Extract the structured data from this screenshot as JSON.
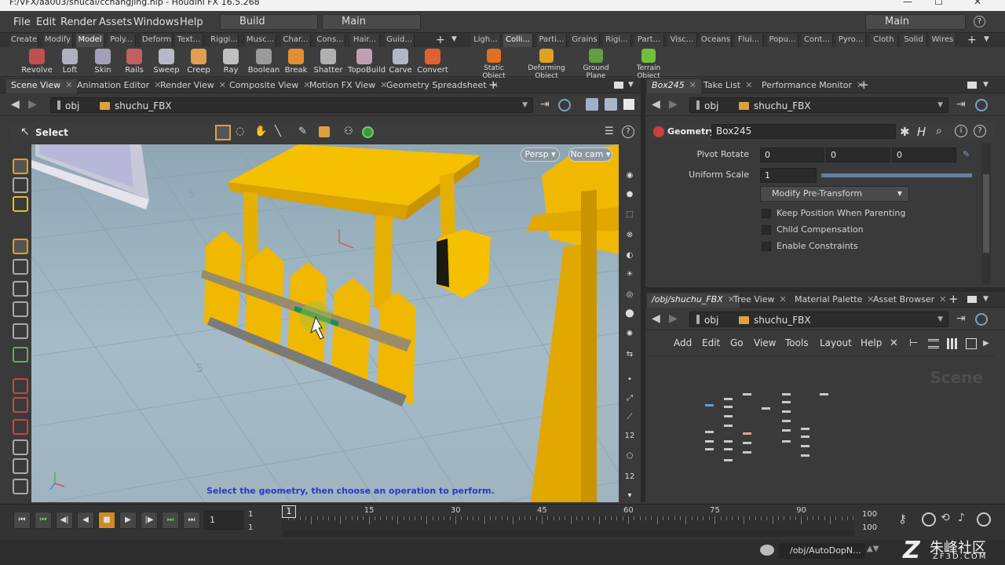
{
  "title_bar": {
    "text": "F:/VFX/aa003/shucai/cchangjing.hip - Houdini FX 16.5.268",
    "minimize": "—",
    "maximize": "☐",
    "close": "✕"
  },
  "menu": {
    "items": [
      "File",
      "Edit",
      "Render",
      "Assets",
      "Windows",
      "Help"
    ],
    "build_desktop": "Build",
    "main_desktop": "Main",
    "right_desktop": "Main",
    "help_glyph": "?"
  },
  "shelf": {
    "left_tabs": [
      "Create",
      "Modify",
      "Model",
      "Poly...",
      "Deform",
      "Text...",
      "Riggi...",
      "Musc...",
      "Char...",
      "Cons...",
      "Hair...",
      "Guid..."
    ],
    "left_active": "Model",
    "right_tabs": [
      "Ligh...",
      "Colli...",
      "Parti...",
      "Grains",
      "Rigi...",
      "Part...",
      "Visc...",
      "Oceans",
      "Flui...",
      "Popu...",
      "Cont...",
      "Pyro...",
      "Cloth",
      "Solid",
      "Wires"
    ],
    "right_active": "Colli...",
    "left_tools": [
      {
        "label": "Revolve",
        "color": "#c05050"
      },
      {
        "label": "Loft",
        "color": "#b0b0c0"
      },
      {
        "label": "Skin",
        "color": "#a0a0b8"
      },
      {
        "label": "Rails",
        "color": "#c06060"
      },
      {
        "label": "Sweep",
        "color": "#b8b8c8"
      },
      {
        "label": "Creep",
        "color": "#e0a050"
      },
      {
        "label": "Ray",
        "color": "#c0c0c0"
      },
      {
        "label": "Boolean",
        "color": "#9a9a9a"
      },
      {
        "label": "Break",
        "color": "#e09030"
      },
      {
        "label": "Shatter",
        "color": "#b0b0b0"
      },
      {
        "label": "TopoBuild",
        "color": "#c0a0b0"
      },
      {
        "label": "Carve",
        "color": "#b0b8c8"
      },
      {
        "label": "Convert",
        "color": "#e06030"
      }
    ],
    "right_tools": [
      {
        "label": "Static Object",
        "color": "#e07020"
      },
      {
        "label": "Deforming Object",
        "color": "#e0a020"
      },
      {
        "label": "Ground Plane",
        "color": "#60a040"
      },
      {
        "label": "Terrain Object",
        "color": "#70c040"
      }
    ]
  },
  "left_pane": {
    "tabs": [
      "Scene View",
      "Animation Editor",
      "Render View",
      "Composite View",
      "Motion FX View",
      "Geometry Spreadsheet"
    ],
    "active_tab": "Scene View",
    "path": [
      "obj",
      "shuchu_FBX"
    ],
    "select_label": "Select",
    "persp_button": "Persp",
    "cam_button": "No cam",
    "status_message": "Select the geometry, then choose an operation to perform."
  },
  "params_pane": {
    "tabs": [
      "Box245",
      "Take List",
      "Performance Monitor"
    ],
    "active_tab": "Box245",
    "path": [
      "obj",
      "shuchu_FBX"
    ],
    "node_type": "Geometry",
    "node_name": "Box245",
    "pivot_rotate_label": "Pivot Rotate",
    "pivot_rotate": [
      "0",
      "0",
      "0"
    ],
    "uniform_scale_label": "Uniform Scale",
    "uniform_scale": "1",
    "uniform_scale_fraction": 1.0,
    "modify_pre_transform": "Modify Pre-Transform",
    "checkboxes": [
      "Keep Position When Parenting",
      "Child Compensation",
      "Enable Constraints"
    ]
  },
  "network_pane": {
    "tabs": [
      "/obj/shuchu_FBX",
      "Tree View",
      "Material Palette",
      "Asset Browser"
    ],
    "active_tab": "/obj/shuchu_FBX",
    "path": [
      "obj",
      "shuchu_FBX"
    ],
    "menu": [
      "Add",
      "Edit",
      "Go",
      "View",
      "Tools",
      "Layout",
      "Help"
    ],
    "watermark": "Scene"
  },
  "timeline": {
    "current_frame": "1",
    "start_frame": "1",
    "start_frame_2": "1",
    "end_frame": "100",
    "end_frame_2": "100",
    "marker": "1",
    "tick_labels": [
      "15",
      "30",
      "45",
      "60",
      "75",
      "90"
    ]
  },
  "status_bar": {
    "path": "/obj/AutoDopN...",
    "logo_text": "朱峰社区",
    "logo_url_text": "ZF3D.COM"
  },
  "colors": {
    "accent_yellow": "#f2b800",
    "viewport_sky": "#9fb5c1",
    "orange_playhead": "#e08a20"
  }
}
